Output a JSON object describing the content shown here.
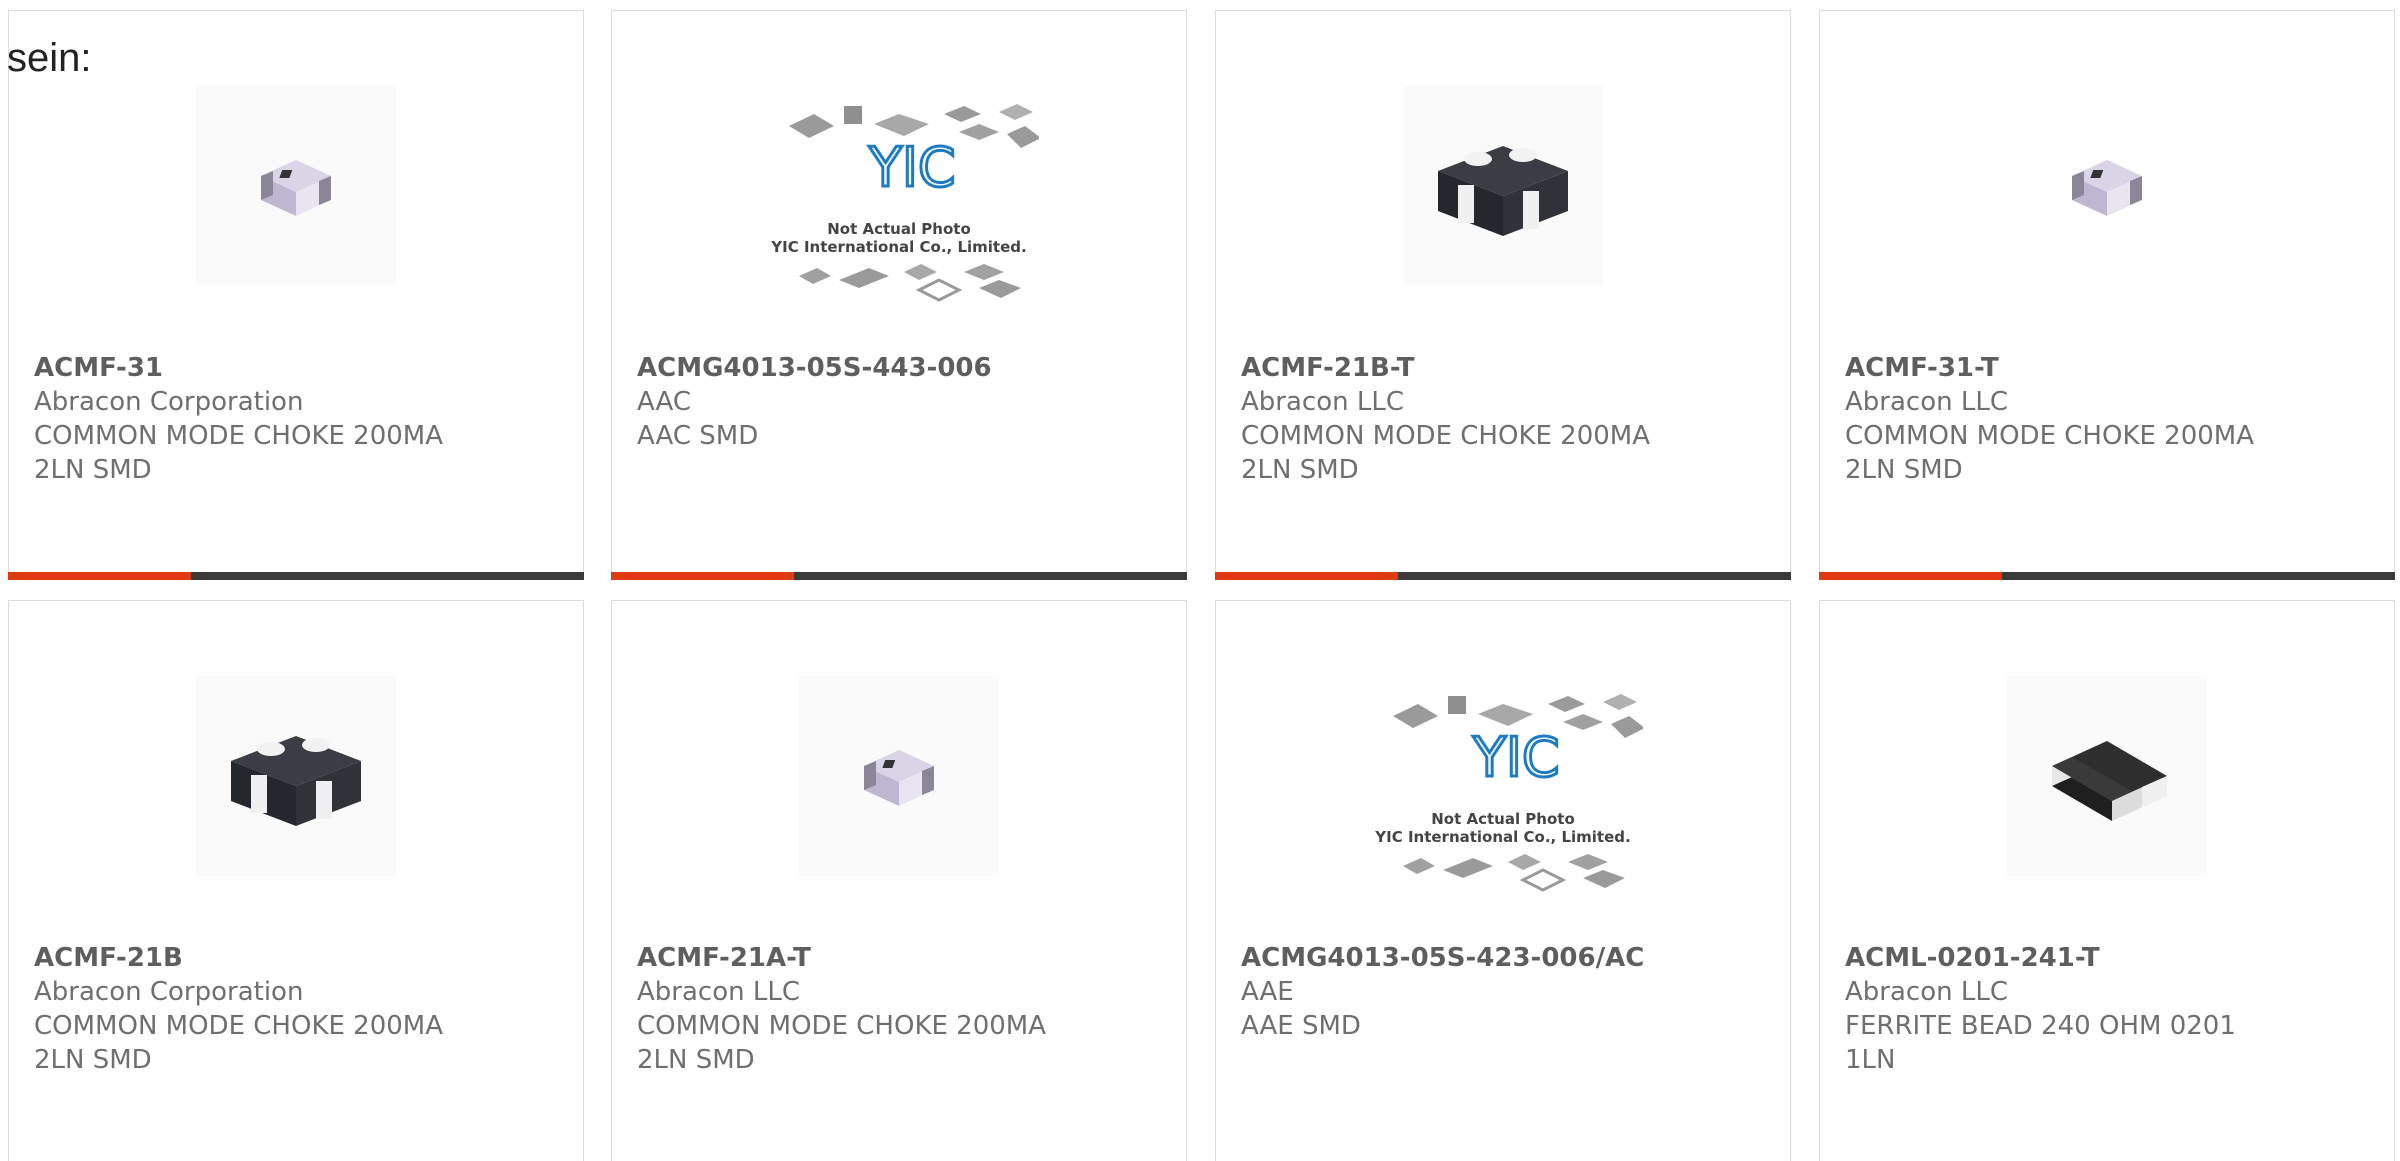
{
  "caption": "sein:",
  "colors": {
    "accent": "#e03a12",
    "bar": "#3a3a3a",
    "border": "#dcdcdc",
    "text": "#6b6b6b"
  },
  "products": [
    {
      "part_number": "ACMF-31",
      "manufacturer": "Abracon Corporation",
      "desc1": "COMMON MODE CHOKE 200MA",
      "desc2": "2LN SMD",
      "image": "smd-choke-light-icon"
    },
    {
      "part_number": "ACMG4013-05S-443-006",
      "manufacturer": "AAC",
      "desc1": "AAC SMD",
      "desc2": "",
      "image": "yic-placeholder-icon",
      "placeholder_lines": [
        "Not Actual Photo",
        "YIC International Co., Limited."
      ],
      "placeholder_logo": "YIC"
    },
    {
      "part_number": "ACMF-21B-T",
      "manufacturer": "Abracon LLC",
      "desc1": "COMMON MODE CHOKE 200MA",
      "desc2": "2LN SMD",
      "image": "smd-choke-dark-icon"
    },
    {
      "part_number": "ACMF-31-T",
      "manufacturer": "Abracon LLC",
      "desc1": "COMMON MODE CHOKE 200MA",
      "desc2": "2LN SMD",
      "image": "smd-choke-light-icon"
    },
    {
      "part_number": "ACMF-21B",
      "manufacturer": "Abracon Corporation",
      "desc1": "COMMON MODE CHOKE 200MA",
      "desc2": "2LN SMD",
      "image": "smd-choke-dark-icon"
    },
    {
      "part_number": "ACMF-21A-T",
      "manufacturer": "Abracon LLC",
      "desc1": "COMMON MODE CHOKE 200MA",
      "desc2": "2LN SMD",
      "image": "smd-choke-light-icon"
    },
    {
      "part_number": "ACMG4013-05S-423-006/AC",
      "manufacturer": "AAE",
      "desc1": "AAE SMD",
      "desc2": "",
      "image": "yic-placeholder-icon",
      "placeholder_lines": [
        "Not Actual Photo",
        "YIC International Co., Limited."
      ],
      "placeholder_logo": "YIC"
    },
    {
      "part_number": "ACML-0201-241-T",
      "manufacturer": "Abracon LLC",
      "desc1": "FERRITE BEAD 240 OHM 0201",
      "desc2": "1LN",
      "image": "ferrite-bead-icon"
    }
  ]
}
